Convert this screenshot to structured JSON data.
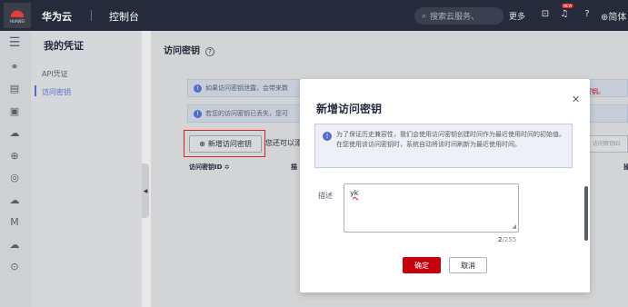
{
  "header": {
    "brand_text": "HUAWEI",
    "title": "华为云",
    "console": "控制台",
    "search_placeholder": "搜索云服务、",
    "more": "更多",
    "new_badge": "NEW",
    "lang": "简体"
  },
  "rail": {
    "icons": [
      "menu-icon",
      "hierarchy-icon",
      "database-icon",
      "document-icon",
      "cloud-icon",
      "globe-icon",
      "compass-icon",
      "cloud-outline-icon",
      "m-icon",
      "cloud-small-icon",
      "target-icon"
    ]
  },
  "sidebar": {
    "title": "我的凭证",
    "items": [
      {
        "label": "API凭证",
        "active": false
      },
      {
        "label": "访问密钥",
        "active": true
      }
    ]
  },
  "main": {
    "title": "访问密钥",
    "help": "?",
    "notice1": "如果访问密钥泄露，会带来数",
    "notice1_tail": "密钥。",
    "notice2": "若您的访问密钥已丢失，您可",
    "add_button": "新增访问密钥",
    "add_hint": "您还可以添",
    "search_placeholder": "访问密钥ID",
    "col_ak": "访问密钥ID ≎",
    "col_2": "描",
    "col_3": "操"
  },
  "modal": {
    "title": "新增访问密钥",
    "info": "为了保证历史兼容性，我们会使用访问密钥创建时间作为最近使用时间的初始值。在您使用该访问密钥时，系统自动将该时间刷新为最近使用时间。",
    "desc_label": "描述",
    "desc_value": "yk",
    "counter_current": "2",
    "counter_max": "/255",
    "ok": "确定",
    "cancel": "取消"
  },
  "colors": {
    "accent_red": "#c7000b",
    "link_blue": "#526ecc",
    "topbar": "#252b3a"
  }
}
